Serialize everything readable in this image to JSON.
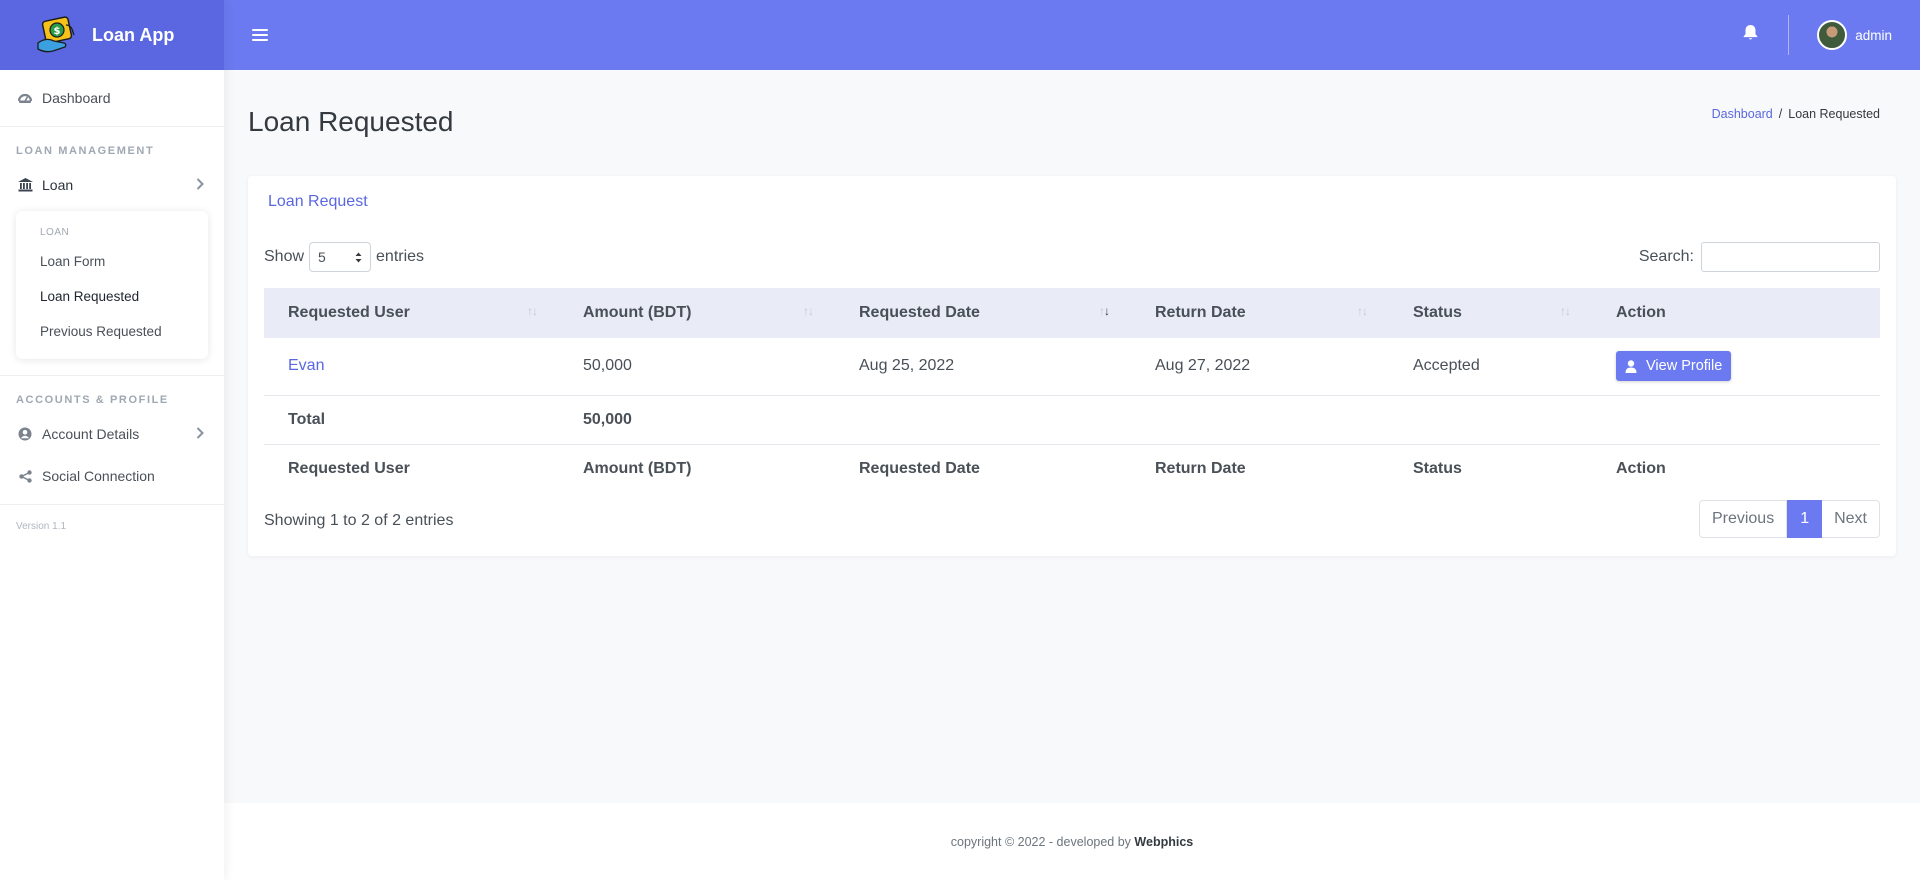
{
  "app": {
    "name": "Loan App"
  },
  "sidebar": {
    "dashboard": "Dashboard",
    "loan_section": "LOAN MANAGEMENT",
    "loan": "Loan",
    "submenu": {
      "title": "LOAN",
      "items": [
        "Loan Form",
        "Loan Requested",
        "Previous Requested"
      ],
      "active": "Loan Requested"
    },
    "accounts_section": "ACCOUNTS & PROFILE",
    "account_details": "Account Details",
    "social_connection": "Social Connection",
    "version": "Version 1.1"
  },
  "header": {
    "username": "admin",
    "icons": [
      "menu-icon",
      "bell-icon"
    ]
  },
  "page": {
    "title": "Loan Requested",
    "breadcrumb": {
      "home": "Dashboard",
      "sep": "/",
      "current": "Loan Requested"
    }
  },
  "card": {
    "title": "Loan Request",
    "show_label": "Show",
    "entries_value": "5",
    "entries_label": "entries",
    "search_label": "Search:",
    "search_value": ""
  },
  "table": {
    "columns": [
      "Requested User",
      "Amount (BDT)",
      "Requested Date",
      "Return Date",
      "Status",
      "Action"
    ],
    "sorted_column": "Requested Date",
    "sort_direction": "descending",
    "rows": [
      {
        "user": "Evan",
        "amount": "50,000",
        "requested_date": "Aug 25, 2022",
        "return_date": "Aug 27, 2022",
        "status": "Accepted",
        "action": "View Profile"
      }
    ],
    "total": {
      "label": "Total",
      "amount": "50,000"
    }
  },
  "pagination": {
    "info": "Showing 1 to 2 of 2 entries",
    "previous": "Previous",
    "current": "1",
    "next": "Next"
  },
  "footer": {
    "text": "copyright © 2022 - developed by ",
    "developer": "Webphics"
  },
  "colors": {
    "brand": "#5a67e0",
    "header": "#6b7af0",
    "table_head": "#e9ecf6"
  }
}
